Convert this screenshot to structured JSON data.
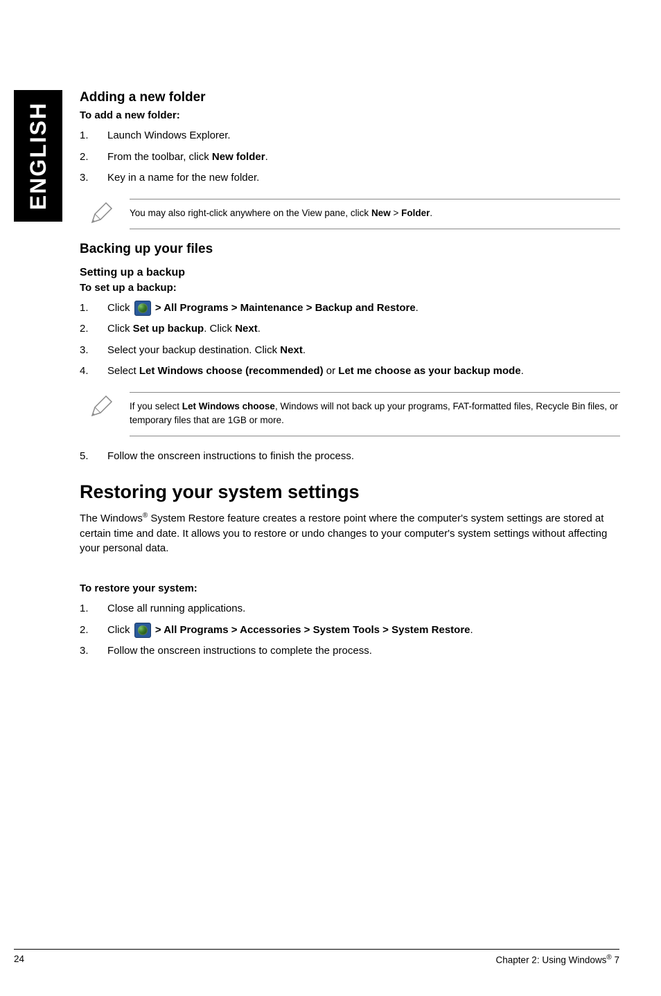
{
  "sidebar": {
    "language": "ENGLISH"
  },
  "section_addfolder": {
    "title": "Adding a new folder",
    "subtitle": "To add a new folder:",
    "steps": [
      "Launch Windows Explorer.",
      {
        "pre": "From the toolbar, click ",
        "bold": "New folder",
        "post": "."
      },
      "Key in a name for the new folder."
    ],
    "note": {
      "pre": "You may also right-click anywhere on the View pane, click ",
      "b1": "New",
      "mid": " > ",
      "b2": "Folder",
      "post": "."
    }
  },
  "section_backup": {
    "title": "Backing up your files",
    "subheading": "Setting up a backup",
    "subtitle": "To set up a backup:",
    "steps": [
      {
        "type": "startpath",
        "pre": "Click ",
        "path": " > All Programs > Maintenance > Backup and Restore",
        "post": "."
      },
      {
        "pre": "Click ",
        "b1": "Set up backup",
        "mid": ". Click ",
        "b2": "Next",
        "post": "."
      },
      {
        "pre": "Select your backup destination. Click ",
        "b1": "Next",
        "post": "."
      },
      {
        "pre": "Select ",
        "b1": "Let Windows choose (recommended)",
        "mid": " or ",
        "b2": "Let me choose as your backup mode",
        "post": "."
      }
    ],
    "note": {
      "pre": "If you select ",
      "b1": "Let Windows choose",
      "post": ", Windows will not back up your programs, FAT-formatted files, Recycle Bin files, or temporary files that are 1GB or more."
    },
    "step5": "Follow the onscreen instructions to finish the process."
  },
  "section_restore": {
    "title": "Restoring your system settings",
    "intro_pre": "The Windows",
    "intro_sup": "®",
    "intro_post": " System Restore feature creates a restore point where the computer's system settings are stored at certain time and date. It allows you to restore or undo changes to your computer's system settings without affecting your personal data.",
    "subtitle": "To restore your system:",
    "steps": [
      "Close all running applications.",
      {
        "type": "startpath",
        "pre": "Click ",
        "path": " > All Programs > Accessories > System Tools > System Restore",
        "post": "."
      },
      "Follow the onscreen instructions to complete the process."
    ]
  },
  "footer": {
    "page": "24",
    "chapter_pre": "Chapter 2: Using Windows",
    "chapter_sup": "®",
    "chapter_post": " 7"
  }
}
